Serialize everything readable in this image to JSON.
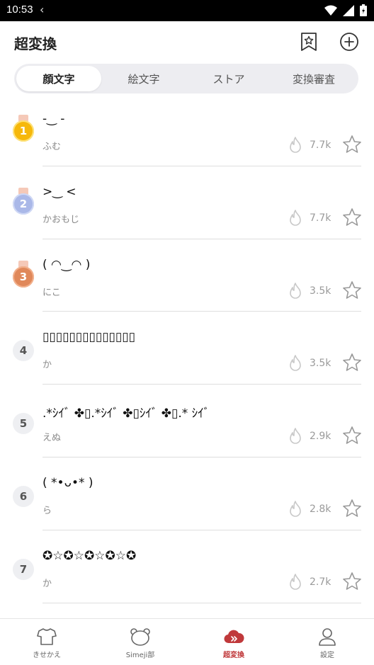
{
  "status_bar": {
    "time": "10:53"
  },
  "header": {
    "title": "超変換"
  },
  "tabs": [
    {
      "label": "顔文字",
      "active": true
    },
    {
      "label": "絵文字",
      "active": false
    },
    {
      "label": "ストア",
      "active": false
    },
    {
      "label": "変換審査",
      "active": false
    }
  ],
  "ranking": [
    {
      "rank": "1",
      "face": "-‿ -",
      "author": "ふむ",
      "count": "7.7k",
      "medal": "gold"
    },
    {
      "rank": "2",
      "face": ">‿ <",
      "author": "かおもじ",
      "count": "7.7k",
      "medal": "silver"
    },
    {
      "rank": "3",
      "face": "( ◠‿◠ )",
      "author": "にこ",
      "count": "3.5k",
      "medal": "bronze"
    },
    {
      "rank": "4",
      "face": "▯▯▯▯▯▯▯▯▯▯▯▯▯▯",
      "author": "か",
      "count": "3.5k",
      "medal": ""
    },
    {
      "rank": "5",
      "face": ".*ｼｲﾞ ✤▯.*ｼｲﾞ ✤▯ｼｲﾞ ✤▯.* ｼｲﾞ",
      "author": "えぬ",
      "count": "2.9k",
      "medal": ""
    },
    {
      "rank": "6",
      "face": "( *•ᴗ•* )",
      "author": "ら",
      "count": "2.8k",
      "medal": ""
    },
    {
      "rank": "7",
      "face": "✪☆✪☆✪☆✪☆✪",
      "author": "か",
      "count": "2.7k",
      "medal": ""
    }
  ],
  "bottom_nav": [
    {
      "label": "きせかえ",
      "icon": "shirt-icon",
      "active": false
    },
    {
      "label": "Simeji部",
      "icon": "bear-icon",
      "active": false
    },
    {
      "label": "超変換",
      "icon": "cloud-icon",
      "active": true
    },
    {
      "label": "設定",
      "icon": "person-icon",
      "active": false
    }
  ],
  "colors": {
    "accent": "#c0393b",
    "gold": "#f6b80b",
    "silver": "#aab8e8",
    "bronze": "#e0885a"
  }
}
